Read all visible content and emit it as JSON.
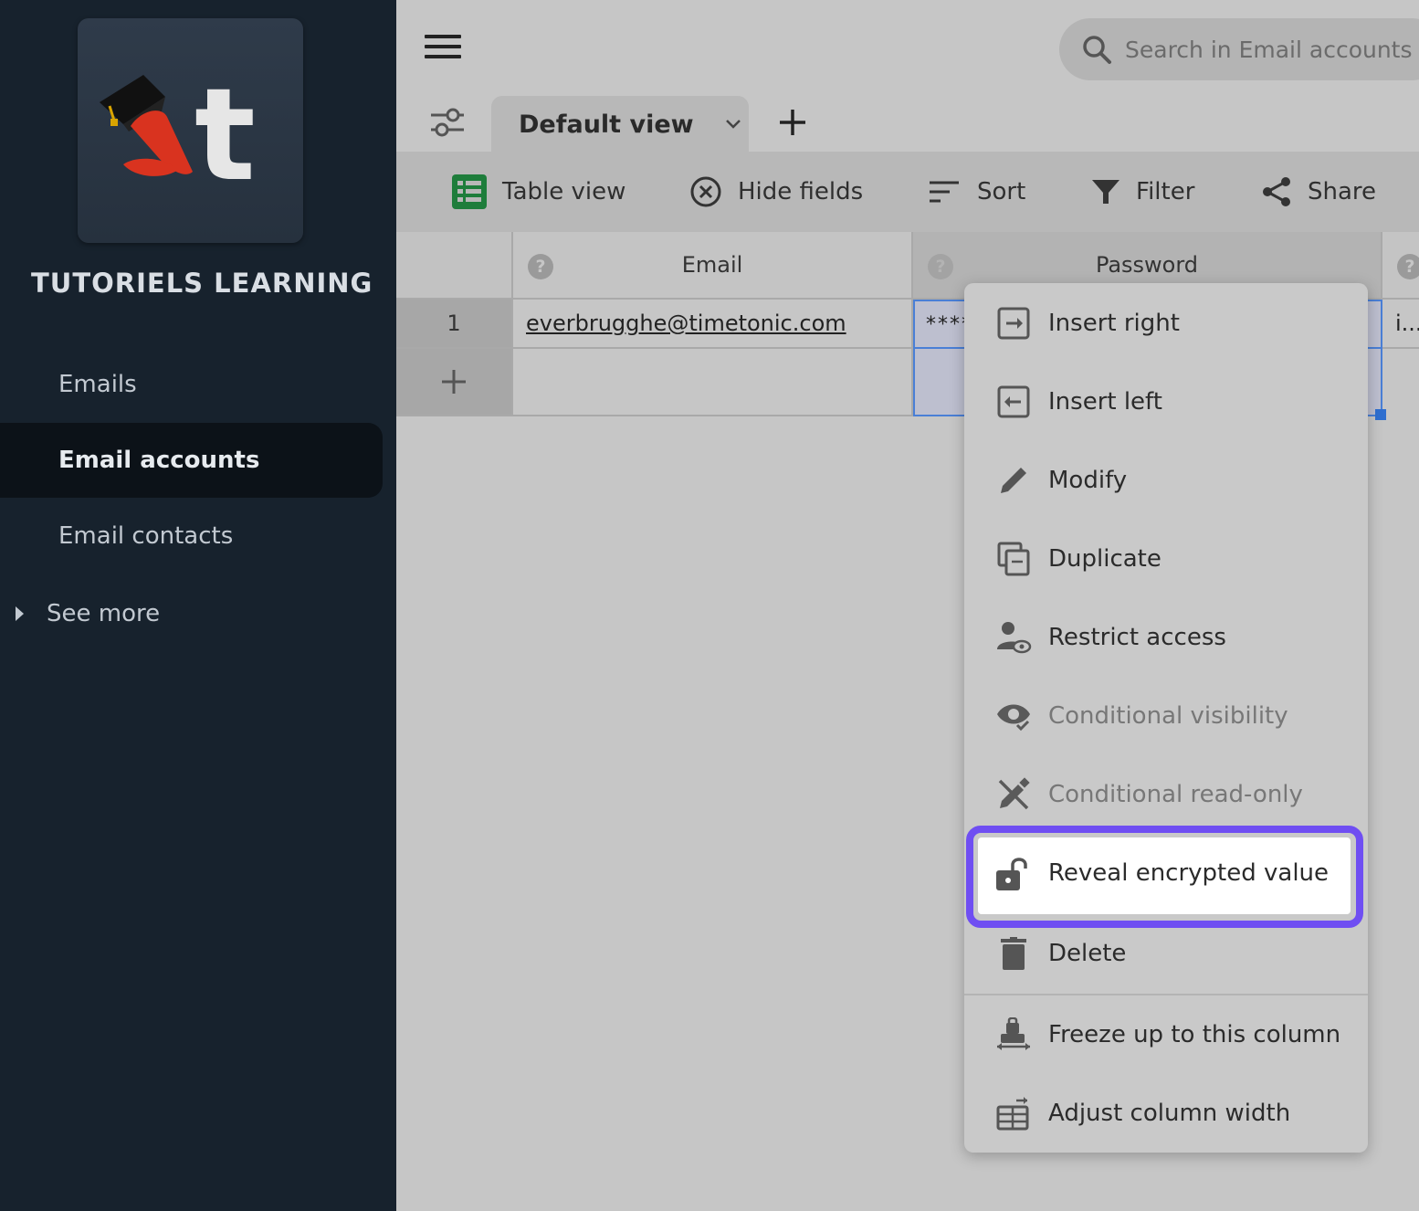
{
  "sidebar": {
    "workspace_name": "TUTORIELS LEARNING",
    "items": [
      {
        "label": "Emails"
      },
      {
        "label": "Email accounts"
      },
      {
        "label": "Email contacts"
      }
    ],
    "see_more": "See more"
  },
  "search": {
    "placeholder": "Search in Email accounts -"
  },
  "views": {
    "current": "Default view"
  },
  "toolbar": {
    "table_view": "Table view",
    "hide_fields": "Hide fields",
    "sort": "Sort",
    "filter": "Filter",
    "share": "Share"
  },
  "table": {
    "columns": [
      "Email",
      "Password"
    ],
    "rows": [
      {
        "num": "1",
        "email": "everbrugghe@timetonic.com",
        "password": "****",
        "extra": "i..."
      }
    ]
  },
  "context_menu": {
    "items": [
      {
        "label": "Insert right",
        "icon": "insert-right-icon"
      },
      {
        "label": "Insert left",
        "icon": "insert-left-icon"
      },
      {
        "label": "Modify",
        "icon": "pencil-icon"
      },
      {
        "label": "Duplicate",
        "icon": "duplicate-icon"
      },
      {
        "label": "Restrict access",
        "icon": "restrict-access-icon"
      },
      {
        "label": "Conditional visibility",
        "icon": "eye-check-icon",
        "disabled": true
      },
      {
        "label": "Conditional read-only",
        "icon": "pencil-off-icon",
        "disabled": true
      },
      {
        "label": "Reveal encrypted value",
        "icon": "unlock-icon",
        "highlighted": true
      },
      {
        "label": "Delete",
        "icon": "trash-icon"
      },
      {
        "label": "Freeze up to this column",
        "icon": "freeze-icon"
      },
      {
        "label": "Adjust column width",
        "icon": "table-width-icon"
      }
    ]
  },
  "colors": {
    "sidebar_bg": "#17222d",
    "highlight_border": "#6f4ef2",
    "table_view_icon": "#1e7d3b"
  }
}
